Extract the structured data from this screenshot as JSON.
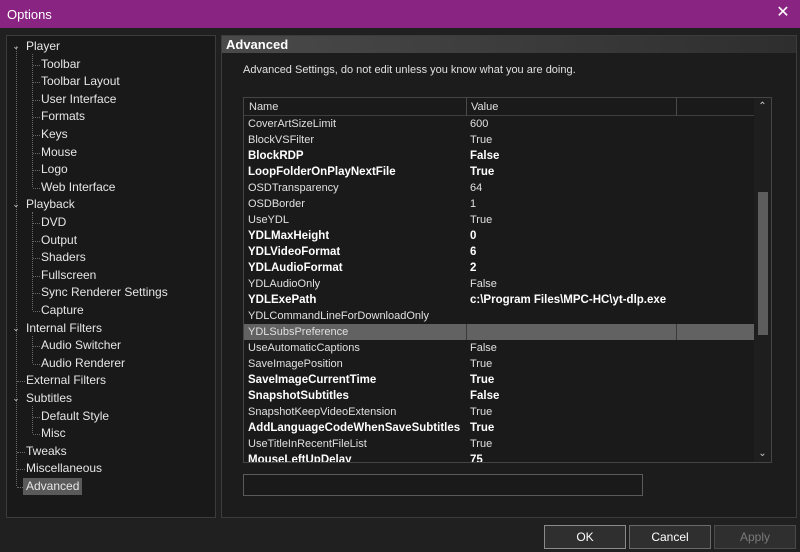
{
  "window": {
    "title": "Options",
    "close_glyph": "✕"
  },
  "tree": {
    "expand_glyph": "⌄",
    "nodes": [
      "Player",
      "Toolbar",
      "Toolbar Layout",
      "User Interface",
      "Formats",
      "Keys",
      "Mouse",
      "Logo",
      "Web Interface",
      "Playback",
      "DVD",
      "Output",
      "Shaders",
      "Fullscreen",
      "Sync Renderer Settings",
      "Capture",
      "Internal Filters",
      "Audio Switcher",
      "Audio Renderer",
      "External Filters",
      "Subtitles",
      "Default Style",
      "Misc",
      "Tweaks",
      "Miscellaneous",
      "Advanced"
    ],
    "selected": "Advanced"
  },
  "panel": {
    "header": "Advanced",
    "description": "Advanced Settings, do not edit unless you know what you are doing."
  },
  "list": {
    "columns": [
      "Name",
      "Value"
    ],
    "rows": [
      {
        "name": "CoverArtSizeLimit",
        "value": "600",
        "bold": false
      },
      {
        "name": "BlockVSFilter",
        "value": "True",
        "bold": false
      },
      {
        "name": "BlockRDP",
        "value": "False",
        "bold": true
      },
      {
        "name": "LoopFolderOnPlayNextFile",
        "value": "True",
        "bold": true
      },
      {
        "name": "OSDTransparency",
        "value": "64",
        "bold": false
      },
      {
        "name": "OSDBorder",
        "value": "1",
        "bold": false
      },
      {
        "name": "UseYDL",
        "value": "True",
        "bold": false
      },
      {
        "name": "YDLMaxHeight",
        "value": "0",
        "bold": true
      },
      {
        "name": "YDLVideoFormat",
        "value": "6",
        "bold": true
      },
      {
        "name": "YDLAudioFormat",
        "value": "2",
        "bold": true
      },
      {
        "name": "YDLAudioOnly",
        "value": "False",
        "bold": false
      },
      {
        "name": "YDLExePath",
        "value": "c:\\Program Files\\MPC-HC\\yt-dlp.exe",
        "bold": true
      },
      {
        "name": "YDLCommandLineForDownloadOnly",
        "value": "",
        "bold": false
      },
      {
        "name": "YDLSubsPreference",
        "value": "",
        "bold": false
      },
      {
        "name": "UseAutomaticCaptions",
        "value": "False",
        "bold": false
      },
      {
        "name": "SaveImagePosition",
        "value": "True",
        "bold": false
      },
      {
        "name": "SaveImageCurrentTime",
        "value": "True",
        "bold": true
      },
      {
        "name": "SnapshotSubtitles",
        "value": "False",
        "bold": true
      },
      {
        "name": "SnapshotKeepVideoExtension",
        "value": "True",
        "bold": false
      },
      {
        "name": "AddLanguageCodeWhenSaveSubtitles",
        "value": "True",
        "bold": true
      },
      {
        "name": "UseTitleInRecentFileList",
        "value": "True",
        "bold": false
      },
      {
        "name": "MouseLeftUpDelay",
        "value": "75",
        "bold": true
      }
    ],
    "selected_row": "YDLSubsPreference",
    "scroll_up_glyph": "⌃",
    "scroll_down_glyph": "⌄"
  },
  "edit": {
    "value": ""
  },
  "buttons": {
    "ok": "OK",
    "cancel": "Cancel",
    "apply": "Apply"
  }
}
